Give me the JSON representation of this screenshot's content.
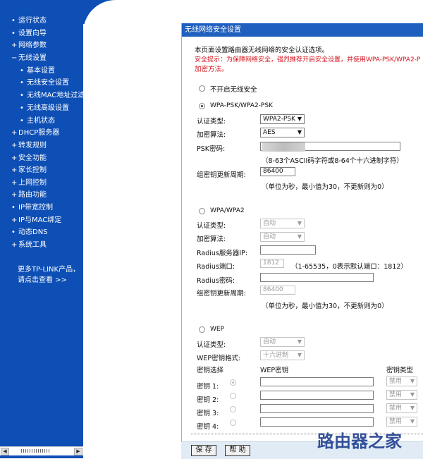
{
  "sidebar": {
    "items": [
      {
        "bullet": "•",
        "label": "运行状态"
      },
      {
        "bullet": "•",
        "label": "设置向导"
      },
      {
        "bullet": "+",
        "label": "网络参数"
      },
      {
        "bullet": "−",
        "label": "无线设置"
      },
      {
        "bullet": "•",
        "label": "基本设置"
      },
      {
        "bullet": "•",
        "label": "无线安全设置"
      },
      {
        "bullet": "•",
        "label": "无线MAC地址过滤"
      },
      {
        "bullet": "•",
        "label": "无线高级设置"
      },
      {
        "bullet": "•",
        "label": "主机状态"
      },
      {
        "bullet": "+",
        "label": "DHCP服务器"
      },
      {
        "bullet": "+",
        "label": "转发规则"
      },
      {
        "bullet": "+",
        "label": "安全功能"
      },
      {
        "bullet": "+",
        "label": "家长控制"
      },
      {
        "bullet": "+",
        "label": "上网控制"
      },
      {
        "bullet": "+",
        "label": "路由功能"
      },
      {
        "bullet": "•",
        "label": "IP带宽控制"
      },
      {
        "bullet": "+",
        "label": "IP与MAC绑定"
      },
      {
        "bullet": "•",
        "label": "动态DNS"
      },
      {
        "bullet": "+",
        "label": "系统工具"
      }
    ],
    "promo_line1": "更多TP-LINK产品，",
    "promo_line2": "请点击查看 >>"
  },
  "panel": {
    "title": "无线网络安全设置",
    "intro": "本页面设置路由器无线网络的安全认证选项。",
    "warn1": "安全提示：为保障网络安全，强烈推荐开启安全设置，并使用WPA-PSK/WPA2-P",
    "warn2": "加密方法。"
  },
  "no_security": {
    "label": "不开启无线安全"
  },
  "psk": {
    "label": "WPA-PSK/WPA2-PSK",
    "auth_label": "认证类型:",
    "auth_value": "WPA2-PSK",
    "enc_label": "加密算法:",
    "enc_value": "AES",
    "pwd_label": "PSK密码:",
    "pwd_hint": "（8-63个ASCII码字符或8-64个十六进制字符）",
    "period_label": "组密钥更新周期:",
    "period_value": "86400",
    "period_hint": "（单位为秒，最小值为30，不更新则为0）"
  },
  "wpa": {
    "label": "WPA/WPA2",
    "auth_label": "认证类型:",
    "auth_value": "自动",
    "enc_label": "加密算法:",
    "enc_value": "自动",
    "ip_label": "Radius服务器IP:",
    "port_label": "Radius端口:",
    "port_value": "1812",
    "port_hint": "（1-65535，0表示默认端口：1812）",
    "pwd_label": "Radius密码:",
    "period_label": "组密钥更新周期:",
    "period_value": "86400",
    "period_hint": "（单位为秒，最小值为30，不更新则为0）"
  },
  "wep": {
    "label": "WEP",
    "auth_label": "认证类型:",
    "auth_value": "自动",
    "fmt_label": "WEP密钥格式:",
    "fmt_value": "十六进制",
    "col_select": "密钥选择",
    "col_key": "WEP密钥",
    "col_type": "密钥类型",
    "keys": [
      {
        "label": "密钥 1:",
        "type": "禁用"
      },
      {
        "label": "密钥 2:",
        "type": "禁用"
      },
      {
        "label": "密钥 3:",
        "type": "禁用"
      },
      {
        "label": "密钥 4:",
        "type": "禁用"
      }
    ]
  },
  "buttons": {
    "save": "保 存",
    "help": "帮 助"
  },
  "watermark": "路由器之家"
}
